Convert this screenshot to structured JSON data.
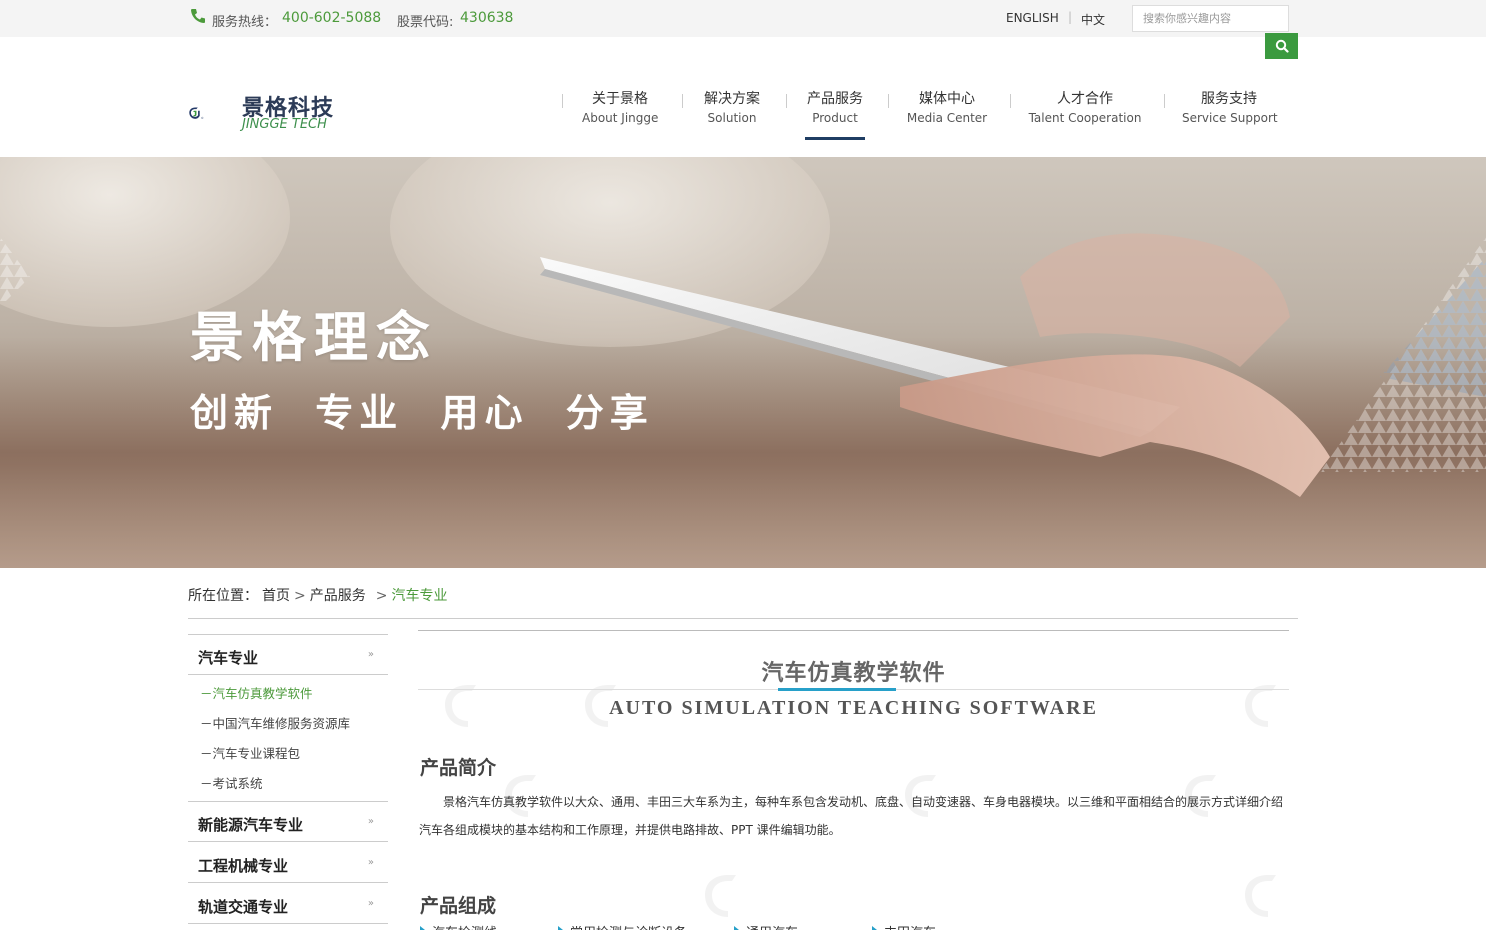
{
  "topbar": {
    "hotline_label": "服务热线：",
    "hotline_number": "400-602-5088",
    "stock_label": "股票代码:",
    "stock_code": "430638",
    "lang_en": "ENGLISH",
    "lang_sep": "|",
    "lang_cn": "中文",
    "search_placeholder": "搜索你感兴趣内容"
  },
  "logo": {
    "cn": "景格科技",
    "en": "JINGGE TECH"
  },
  "nav": [
    {
      "cn": "关于景格",
      "en": "About Jingge"
    },
    {
      "cn": "解决方案",
      "en": "Solution"
    },
    {
      "cn": "产品服务",
      "en": "Product"
    },
    {
      "cn": "媒体中心",
      "en": "Media Center"
    },
    {
      "cn": "人才合作",
      "en": "Talent Cooperation"
    },
    {
      "cn": "服务支持",
      "en": "Service Support"
    }
  ],
  "banner": {
    "title": "景格理念",
    "slogan": "创新 专业 用心 分享"
  },
  "breadcrumb": {
    "prefix": "所在位置：",
    "home": "首页",
    "parent": "产品服务",
    "current": "汽车专业",
    "sep": ">"
  },
  "sidebar": {
    "categories": [
      {
        "label": "汽车专业",
        "arrow": "»"
      },
      {
        "label": "新能源汽车专业",
        "arrow": "»"
      },
      {
        "label": "工程机械专业",
        "arrow": "»"
      },
      {
        "label": "轨道交通专业",
        "arrow": "»"
      }
    ],
    "subitems": [
      "－汽车仿真教学软件",
      "－中国汽车维修服务资源库",
      "－汽车专业课程包",
      "－考试系统"
    ]
  },
  "main": {
    "title": "汽车仿真教学软件",
    "subtitle": "AUTO SIMULATION TEACHING SOFTWARE",
    "intro_heading": "产品简介",
    "intro_text": "景格汽车仿真教学软件以大众、通用、丰田三大车系为主，每种车系包含发动机、底盘、自动变速器、车身电器模块。以三维和平面相结合的展示方式详细介绍汽车各组成模块的基本结构和工作原理，并提供电路排故、PPT 课件编辑功能。",
    "components_heading": "产品组成",
    "components": [
      "汽车检测线",
      "常用检测与诊断设备",
      "通用汽车",
      "丰田汽车"
    ]
  },
  "colors": {
    "accent_green": "#4c9a3b",
    "nav_active": "#1f3d63",
    "title_accent": "#27a0c9",
    "search_button": "#3b9a3f"
  }
}
